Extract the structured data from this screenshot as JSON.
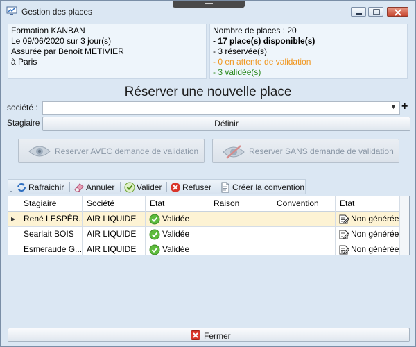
{
  "window": {
    "title": "Gestion des places",
    "icon": "seats-icon"
  },
  "info": {
    "training": "Formation KANBAN",
    "date_line": "Le 09/06/2020 sur 3 jour(s)",
    "trainer_line": "Assurée par Benoît METIVIER",
    "location_line": "à Paris"
  },
  "stats": {
    "total_line": "Nombre de places : 20",
    "available_line": "- 17 place(s) disponible(s)",
    "reserved_line": "- 3 réservée(s)",
    "pending_line": "- 0 en attente de validation",
    "validated_line": "- 3 validée(s)",
    "pending_color": "#f0961e",
    "validated_color": "#2c8a1f"
  },
  "form": {
    "heading": "Réserver une nouvelle place",
    "company_label": "société :",
    "company_value": "",
    "trainee_label": "Stagiaire :",
    "define_button": "Définir",
    "reserve_with_validation": "Reserver AVEC demande de validation",
    "reserve_without_validation": "Reserver SANS demande de validation"
  },
  "toolbar": {
    "refresh": "Rafraichir",
    "cancel": "Annuler",
    "validate": "Valider",
    "refuse": "Refuser",
    "create_convention": "Créer la convention"
  },
  "grid": {
    "columns": [
      "Stagiaire",
      "Société",
      "Etat",
      "Raison",
      "Convention",
      "Etat"
    ],
    "rows": [
      {
        "trainee": "René LESPÉR...",
        "company": "AIR LIQUIDE",
        "status": "Validée",
        "reason": "",
        "convention": "",
        "convention_status": "Non générée",
        "selected": true
      },
      {
        "trainee": "Searlait BOIS",
        "company": "AIR LIQUIDE",
        "status": "Validée",
        "reason": "",
        "convention": "",
        "convention_status": "Non générée",
        "selected": false
      },
      {
        "trainee": "Esmeraude G...",
        "company": "AIR LIQUIDE",
        "status": "Validée",
        "reason": "",
        "convention": "",
        "convention_status": "Non générée",
        "selected": false
      }
    ]
  },
  "footer": {
    "close_button": "Fermer"
  }
}
